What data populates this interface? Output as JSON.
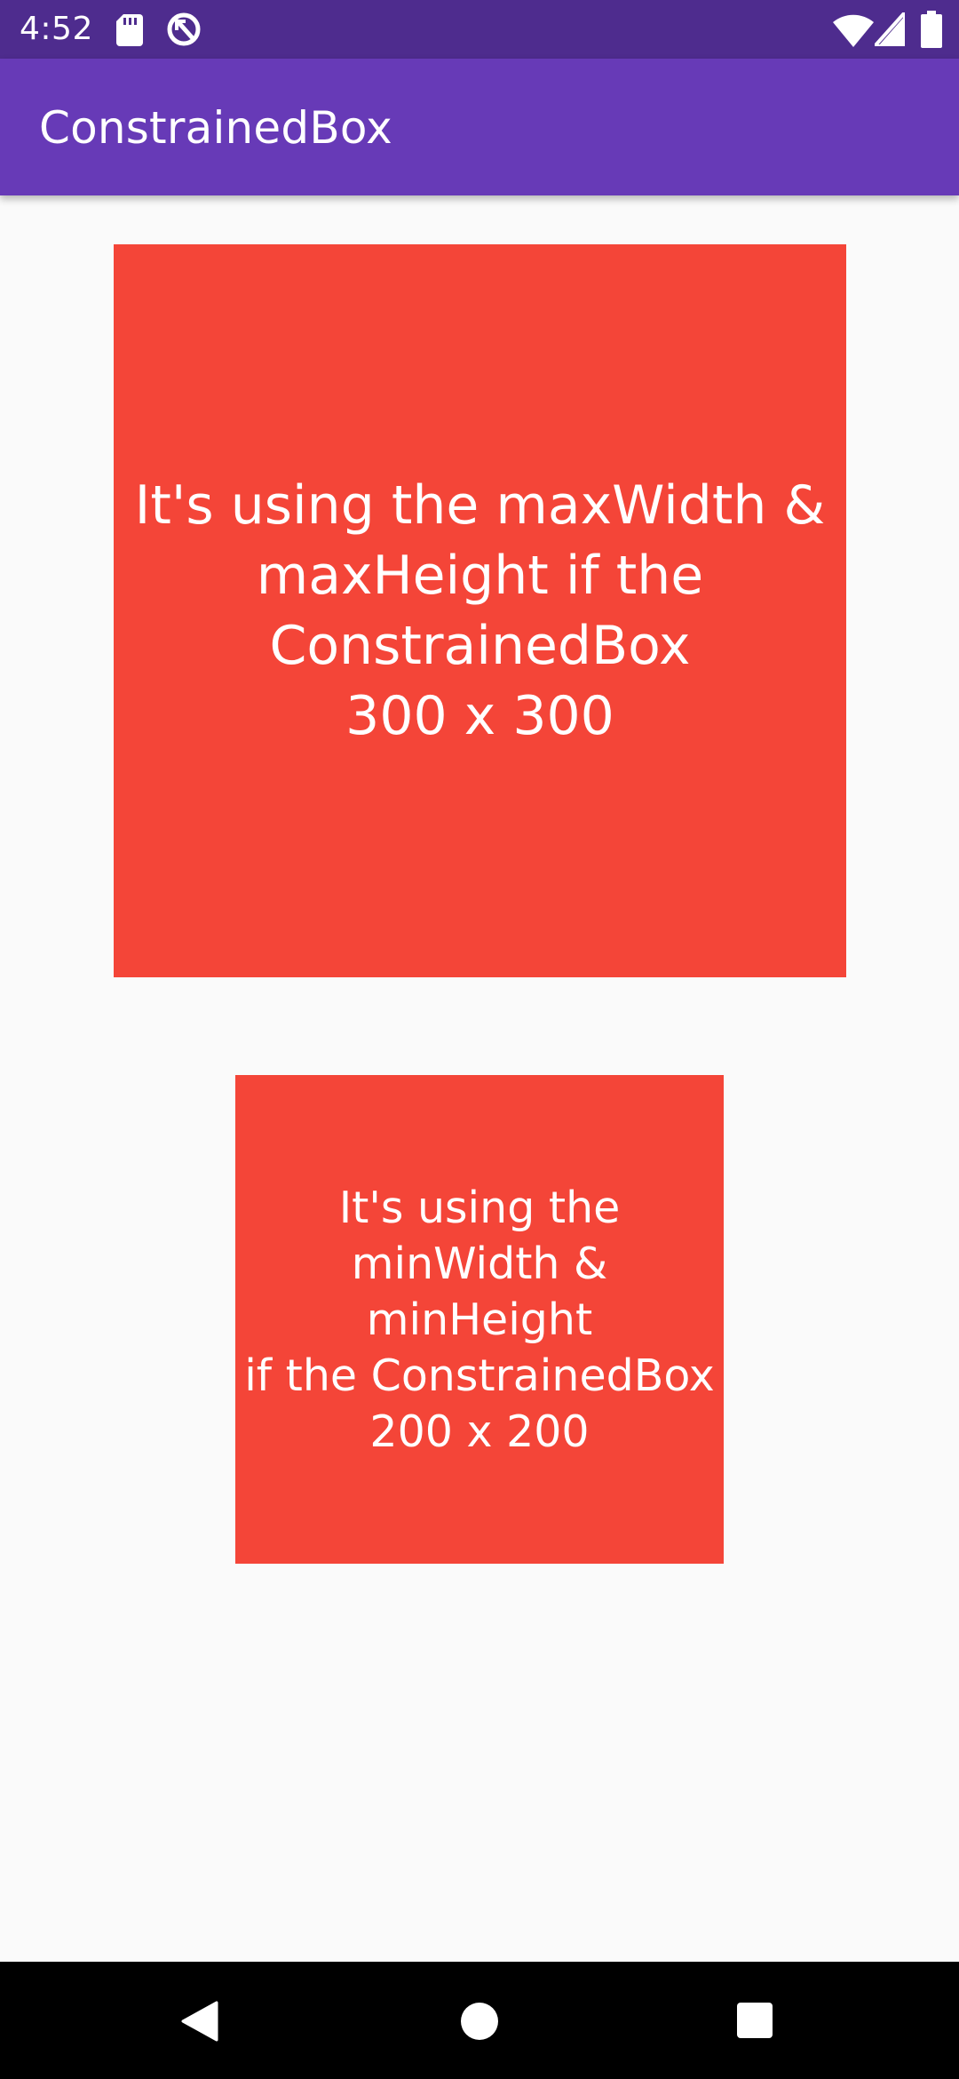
{
  "status_bar": {
    "time": "4:52",
    "icons": [
      "sd-card-icon",
      "sync-icon",
      "wifi-icon",
      "cell-signal-icon",
      "battery-icon"
    ]
  },
  "app_bar": {
    "title": "ConstrainedBox"
  },
  "boxes": [
    {
      "text": "It's using the maxWidth &\nmaxHeight if the\nConstrainedBox\n300 x 300"
    },
    {
      "text": "It's using the\nminWidth & minHeight\nif the ConstrainedBox\n200 x 200"
    }
  ],
  "nav_bar": {
    "icons": [
      "back-icon",
      "home-icon",
      "recents-icon"
    ]
  },
  "colors": {
    "status_bar": "#4e2c8e",
    "app_bar": "#673ab7",
    "box": "#f44538",
    "background": "#fafafa",
    "nav_bar": "#000000"
  }
}
